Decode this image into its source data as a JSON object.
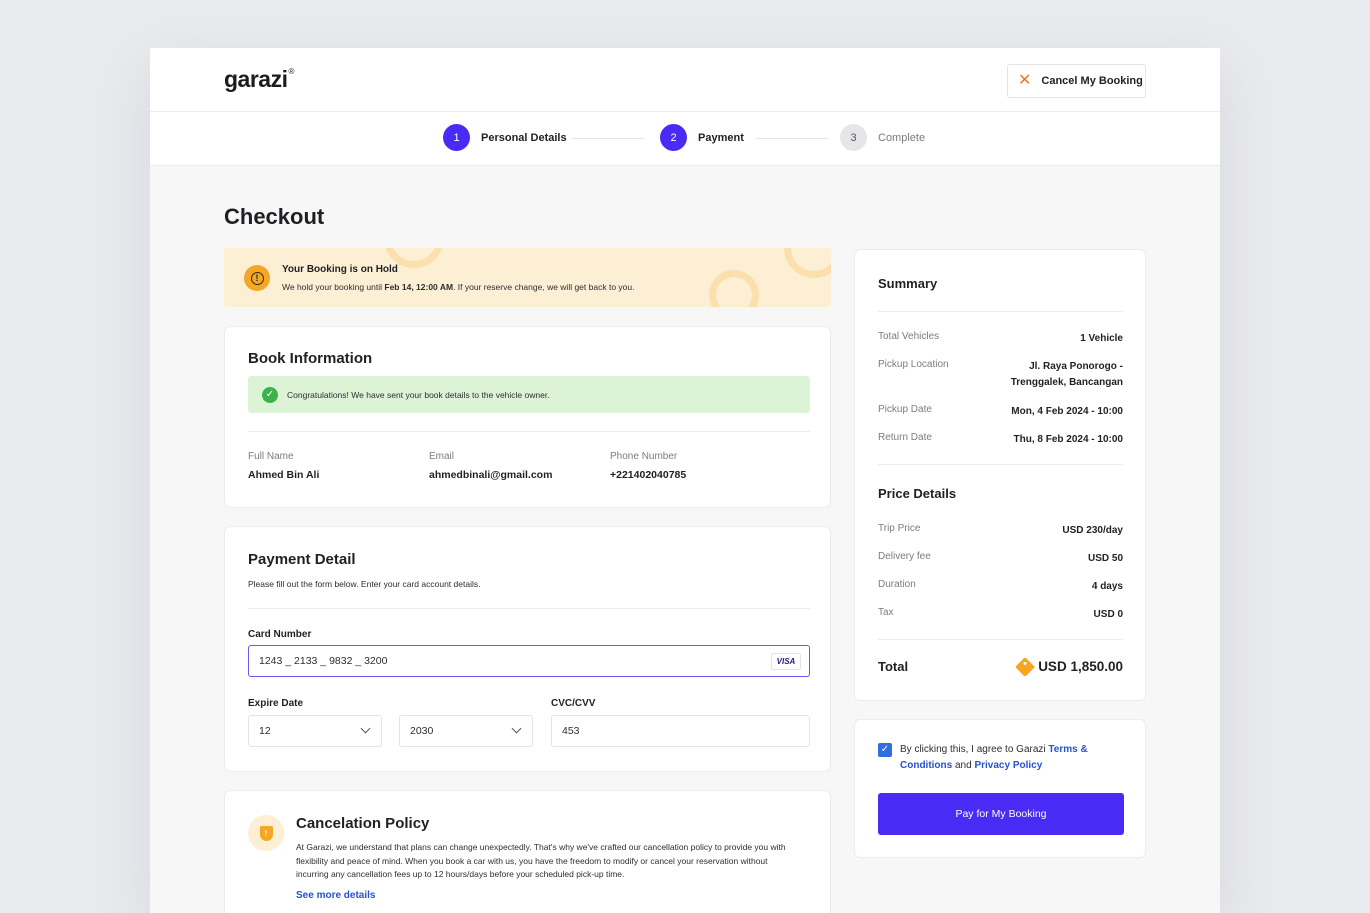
{
  "header": {
    "logo": "garazi",
    "logo_mark": "®",
    "cancel_label": "Cancel My Booking"
  },
  "steps": [
    {
      "num": "1",
      "label": "Personal Details"
    },
    {
      "num": "2",
      "label": "Payment"
    },
    {
      "num": "3",
      "label": "Complete"
    }
  ],
  "page_title": "Checkout",
  "hold": {
    "title": "Your Booking is on Hold",
    "text_before": "We hold your booking until ",
    "text_bold": "Feb 14, 12:00 AM",
    "text_after": ". If your reserve change, we will get back to you."
  },
  "book_info": {
    "title": "Book Information",
    "success": "Congratulations! We have sent your book details to the vehicle owner.",
    "full_name_label": "Full Name",
    "full_name": "Ahmed Bin Ali",
    "email_label": "Email",
    "email": "ahmedbinali@gmail.com",
    "phone_label": "Phone Number",
    "phone": "+221402040785"
  },
  "payment": {
    "title": "Payment Detail",
    "subtitle": "Please fill out the form below. Enter your card account details.",
    "card_label": "Card Number",
    "card_value": "1243  _  2133  _ 9832 _ 3200",
    "card_brand": "VISA",
    "expire_label": "Expire Date",
    "month": "12",
    "year": "2030",
    "cvc_label": "CVC/CVV",
    "cvc": "453"
  },
  "policy": {
    "title": "Cancelation Policy",
    "text": "At Garazi, we understand that plans can change unexpectedly. That's why we've crafted our cancellation policy to provide you with flexibility and peace of mind. When you book a car with us, you have the freedom to modify or cancel your reservation without incurring any cancellation fees up to 12 hours/days before your scheduled pick-up time.",
    "link": "See more details"
  },
  "summary": {
    "title": "Summary",
    "rows": [
      {
        "k": "Total Vehicles",
        "v": "1 Vehicle"
      },
      {
        "k": "Pickup Location",
        "v1": "Jl. Raya Ponorogo -",
        "v2": "Trenggalek, Bancangan"
      },
      {
        "k": "Pickup Date",
        "v": "Mon, 4 Feb 2024 - 10:00"
      },
      {
        "k": "Return Date",
        "v": "Thu, 8 Feb 2024 - 10:00"
      }
    ],
    "price_title": "Price Details",
    "price_rows": [
      {
        "k": "Trip Price",
        "v": "USD 230/day"
      },
      {
        "k": "Delivery fee",
        "v": "USD 50"
      },
      {
        "k": "Duration",
        "v": "4 days"
      },
      {
        "k": "Tax",
        "v": "USD 0"
      }
    ],
    "total_label": "Total",
    "total_value": "USD 1,850.00"
  },
  "agree": {
    "text1": "By clicking this, I agree to Garazi ",
    "terms": "Terms & Conditions",
    "and": " and ",
    "privacy": "Privacy Policy",
    "pay_label": "Pay for My Booking"
  },
  "colors": {
    "primary": "#4a2bf5",
    "accent": "#f5a623",
    "success": "#3bb34a",
    "link": "#2451d6"
  }
}
